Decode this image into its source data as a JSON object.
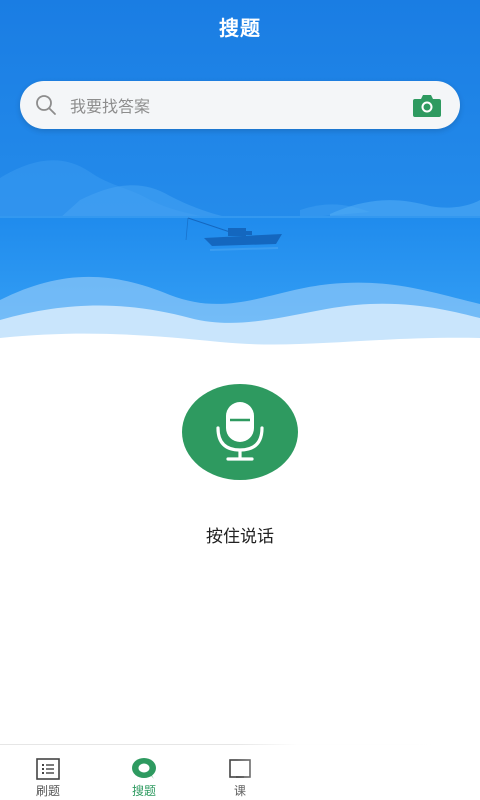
{
  "header": {
    "title": "搜题"
  },
  "search": {
    "placeholder": "我要找答案",
    "value": ""
  },
  "voice": {
    "hold_label": "按住说话"
  },
  "tabbar": {
    "tabs": [
      {
        "label": "刷题",
        "icon": "list-icon",
        "active": false
      },
      {
        "label": "搜题",
        "icon": "search-bubble-icon",
        "active": true
      },
      {
        "label": "课",
        "icon": "course-icon",
        "active": false
      }
    ]
  },
  "colors": {
    "primary_blue": "#1e86ea",
    "accent_green": "#2e9a60",
    "text_dark": "#222222",
    "text_muted": "#8d8d8d"
  }
}
